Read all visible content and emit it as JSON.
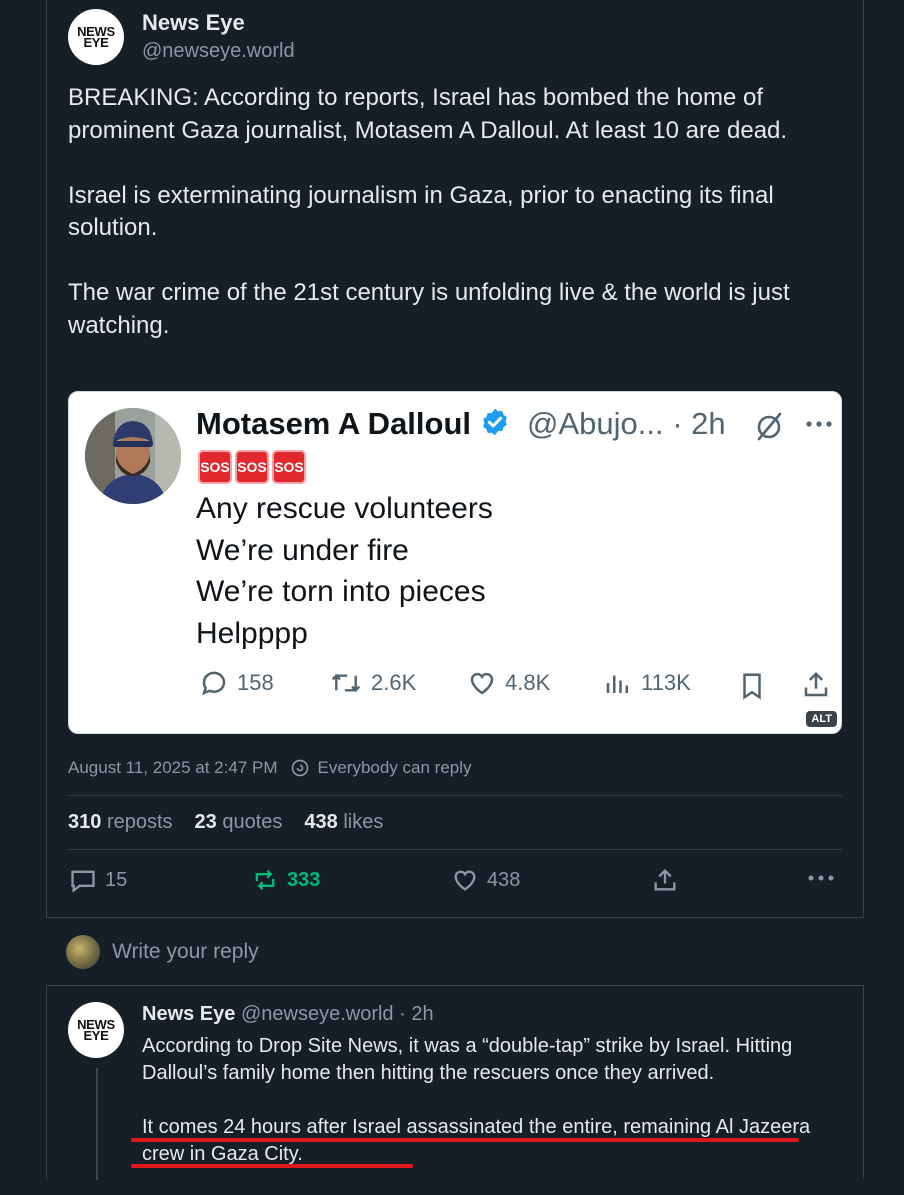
{
  "main_post": {
    "avatar_text_line1": "NEWS",
    "avatar_text_line2": "EYE",
    "display_name": "News Eye",
    "handle": "@newseye.world",
    "paragraphs": [
      "BREAKING: According to reports, Israel has bombed the home of prominent Gaza journalist, Motasem A Dalloul. At least 10 are dead.",
      "Israel is exterminating journalism in Gaza, prior to enacting its final solution.",
      "The war crime of the 21st century is unfolding live & the world is just watching."
    ],
    "embedded_image": {
      "name": "Motasem A Dalloul",
      "handle_time": "@Abujo... · 2h",
      "sos_label": "SOS",
      "lines": [
        "Any rescue volunteers",
        "We’re under fire",
        "We’re torn into pieces",
        "Helpppp"
      ],
      "replies": "158",
      "reposts": "2.6K",
      "likes": "4.8K",
      "views": "113K",
      "alt_badge": "ALT"
    },
    "timestamp": "August 11, 2025 at 2:47 PM",
    "reply_setting": "Everybody can reply",
    "stats": {
      "reposts_count": "310",
      "reposts_label": "reposts",
      "quotes_count": "23",
      "quotes_label": "quotes",
      "likes_count": "438",
      "likes_label": "likes"
    },
    "actions": {
      "replies": "15",
      "reposts": "333",
      "likes": "438"
    }
  },
  "reply_composer": {
    "placeholder": "Write your reply"
  },
  "reply_post": {
    "display_name": "News Eye",
    "handle_time": "@newseye.world · 2h",
    "paragraphs": [
      "According to Drop Site News, it was a “double-tap” strike by Israel. Hitting Dalloul’s family home then hitting the rescuers once they arrived.",
      "It comes 24 hours after Israel assassinated the entire, remaining Al Jazeera crew in Gaza City."
    ]
  },
  "colors": {
    "background": "#161e27",
    "repost_active": "#00ba7c",
    "verified_badge": "#1d9bf0",
    "sos_red": "#e0282e",
    "annotation_red": "#e0161c"
  }
}
